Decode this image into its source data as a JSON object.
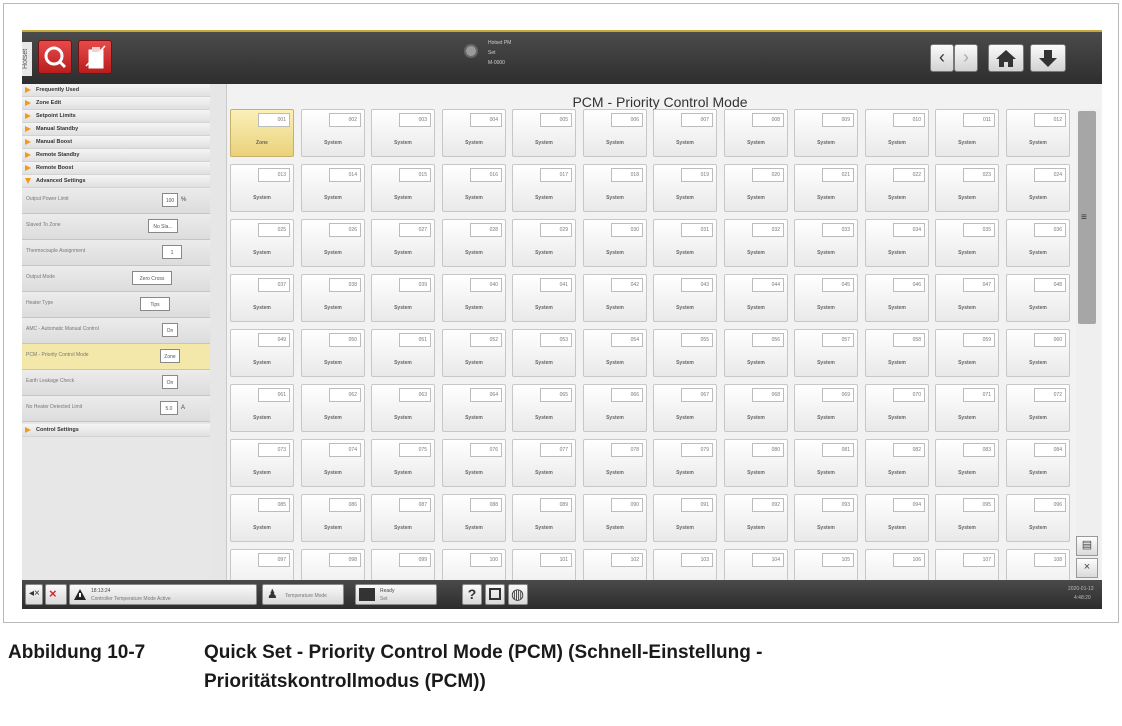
{
  "topbar": {
    "side_tab": "Hotset",
    "status_lines": [
      "Hotset PM",
      "Set",
      "M-0000"
    ],
    "nav_prev": "‹",
    "nav_next": "›",
    "home_icon": "home-icon",
    "download_icon": "download-arrow-icon"
  },
  "sidebar": {
    "menu_items": [
      {
        "label": "Frequently Used",
        "open": false
      },
      {
        "label": "Zone Edit",
        "open": false
      },
      {
        "label": "Setpoint Limits",
        "open": false
      },
      {
        "label": "Manual Standby",
        "open": false
      },
      {
        "label": "Manual Boost",
        "open": false
      },
      {
        "label": "Remote Standby",
        "open": false
      },
      {
        "label": "Remote Boost",
        "open": false
      },
      {
        "label": "Advanced Settings",
        "open": true
      }
    ],
    "settings": [
      {
        "label": "Output Power Limit",
        "value": "100",
        "unit": "%",
        "highlight": false
      },
      {
        "label": "Slaved To Zone",
        "value": "No Sla...",
        "unit": "",
        "highlight": false
      },
      {
        "label": "Thermocouple Assignment",
        "value": "1",
        "unit": "",
        "highlight": false
      },
      {
        "label": "Output Mode",
        "value": "Zero Cross",
        "unit": "",
        "highlight": false
      },
      {
        "label": "Heater Type",
        "value": "Tips",
        "unit": "",
        "highlight": false
      },
      {
        "label": "AMC - Automatic Manual Control",
        "value": "On",
        "unit": "",
        "highlight": false
      },
      {
        "label": "PCM - Priority Control Mode",
        "value": "Zone",
        "unit": "",
        "highlight": true
      },
      {
        "label": "Earth Leakage Check",
        "value": "On",
        "unit": "",
        "highlight": false
      },
      {
        "label": "No Heater Detected Limit",
        "value": "5.0",
        "unit": "A",
        "highlight": false
      }
    ],
    "footer_item": {
      "label": "Control Settings",
      "open": false
    }
  },
  "main": {
    "title": "PCM - Priority Control Mode",
    "zone_label": "Zone",
    "system_label": "System",
    "columns": 12,
    "visible_rows": 9,
    "first_zone_mode": "Zone"
  },
  "bottombar": {
    "time": "18:13:24",
    "alarm_text": "Controller Temperature Mode Active",
    "user_text": "Temperature Mode",
    "ready_text": "Ready",
    "ready_sub": "Set",
    "help": "?",
    "date": "2020-01-13",
    "clock": "4:48:20"
  },
  "caption": {
    "figure": "Abbildung 10-7",
    "line1": "Quick Set - Priority Control Mode (PCM) (Schnell-Einstellung -",
    "line2": "Prioritätskontrollmodus (PCM))"
  },
  "colors": {
    "accent_orange": "#f29a1e",
    "highlight_yellow": "#f3e7a9",
    "brand_red": "#d33a3a"
  }
}
